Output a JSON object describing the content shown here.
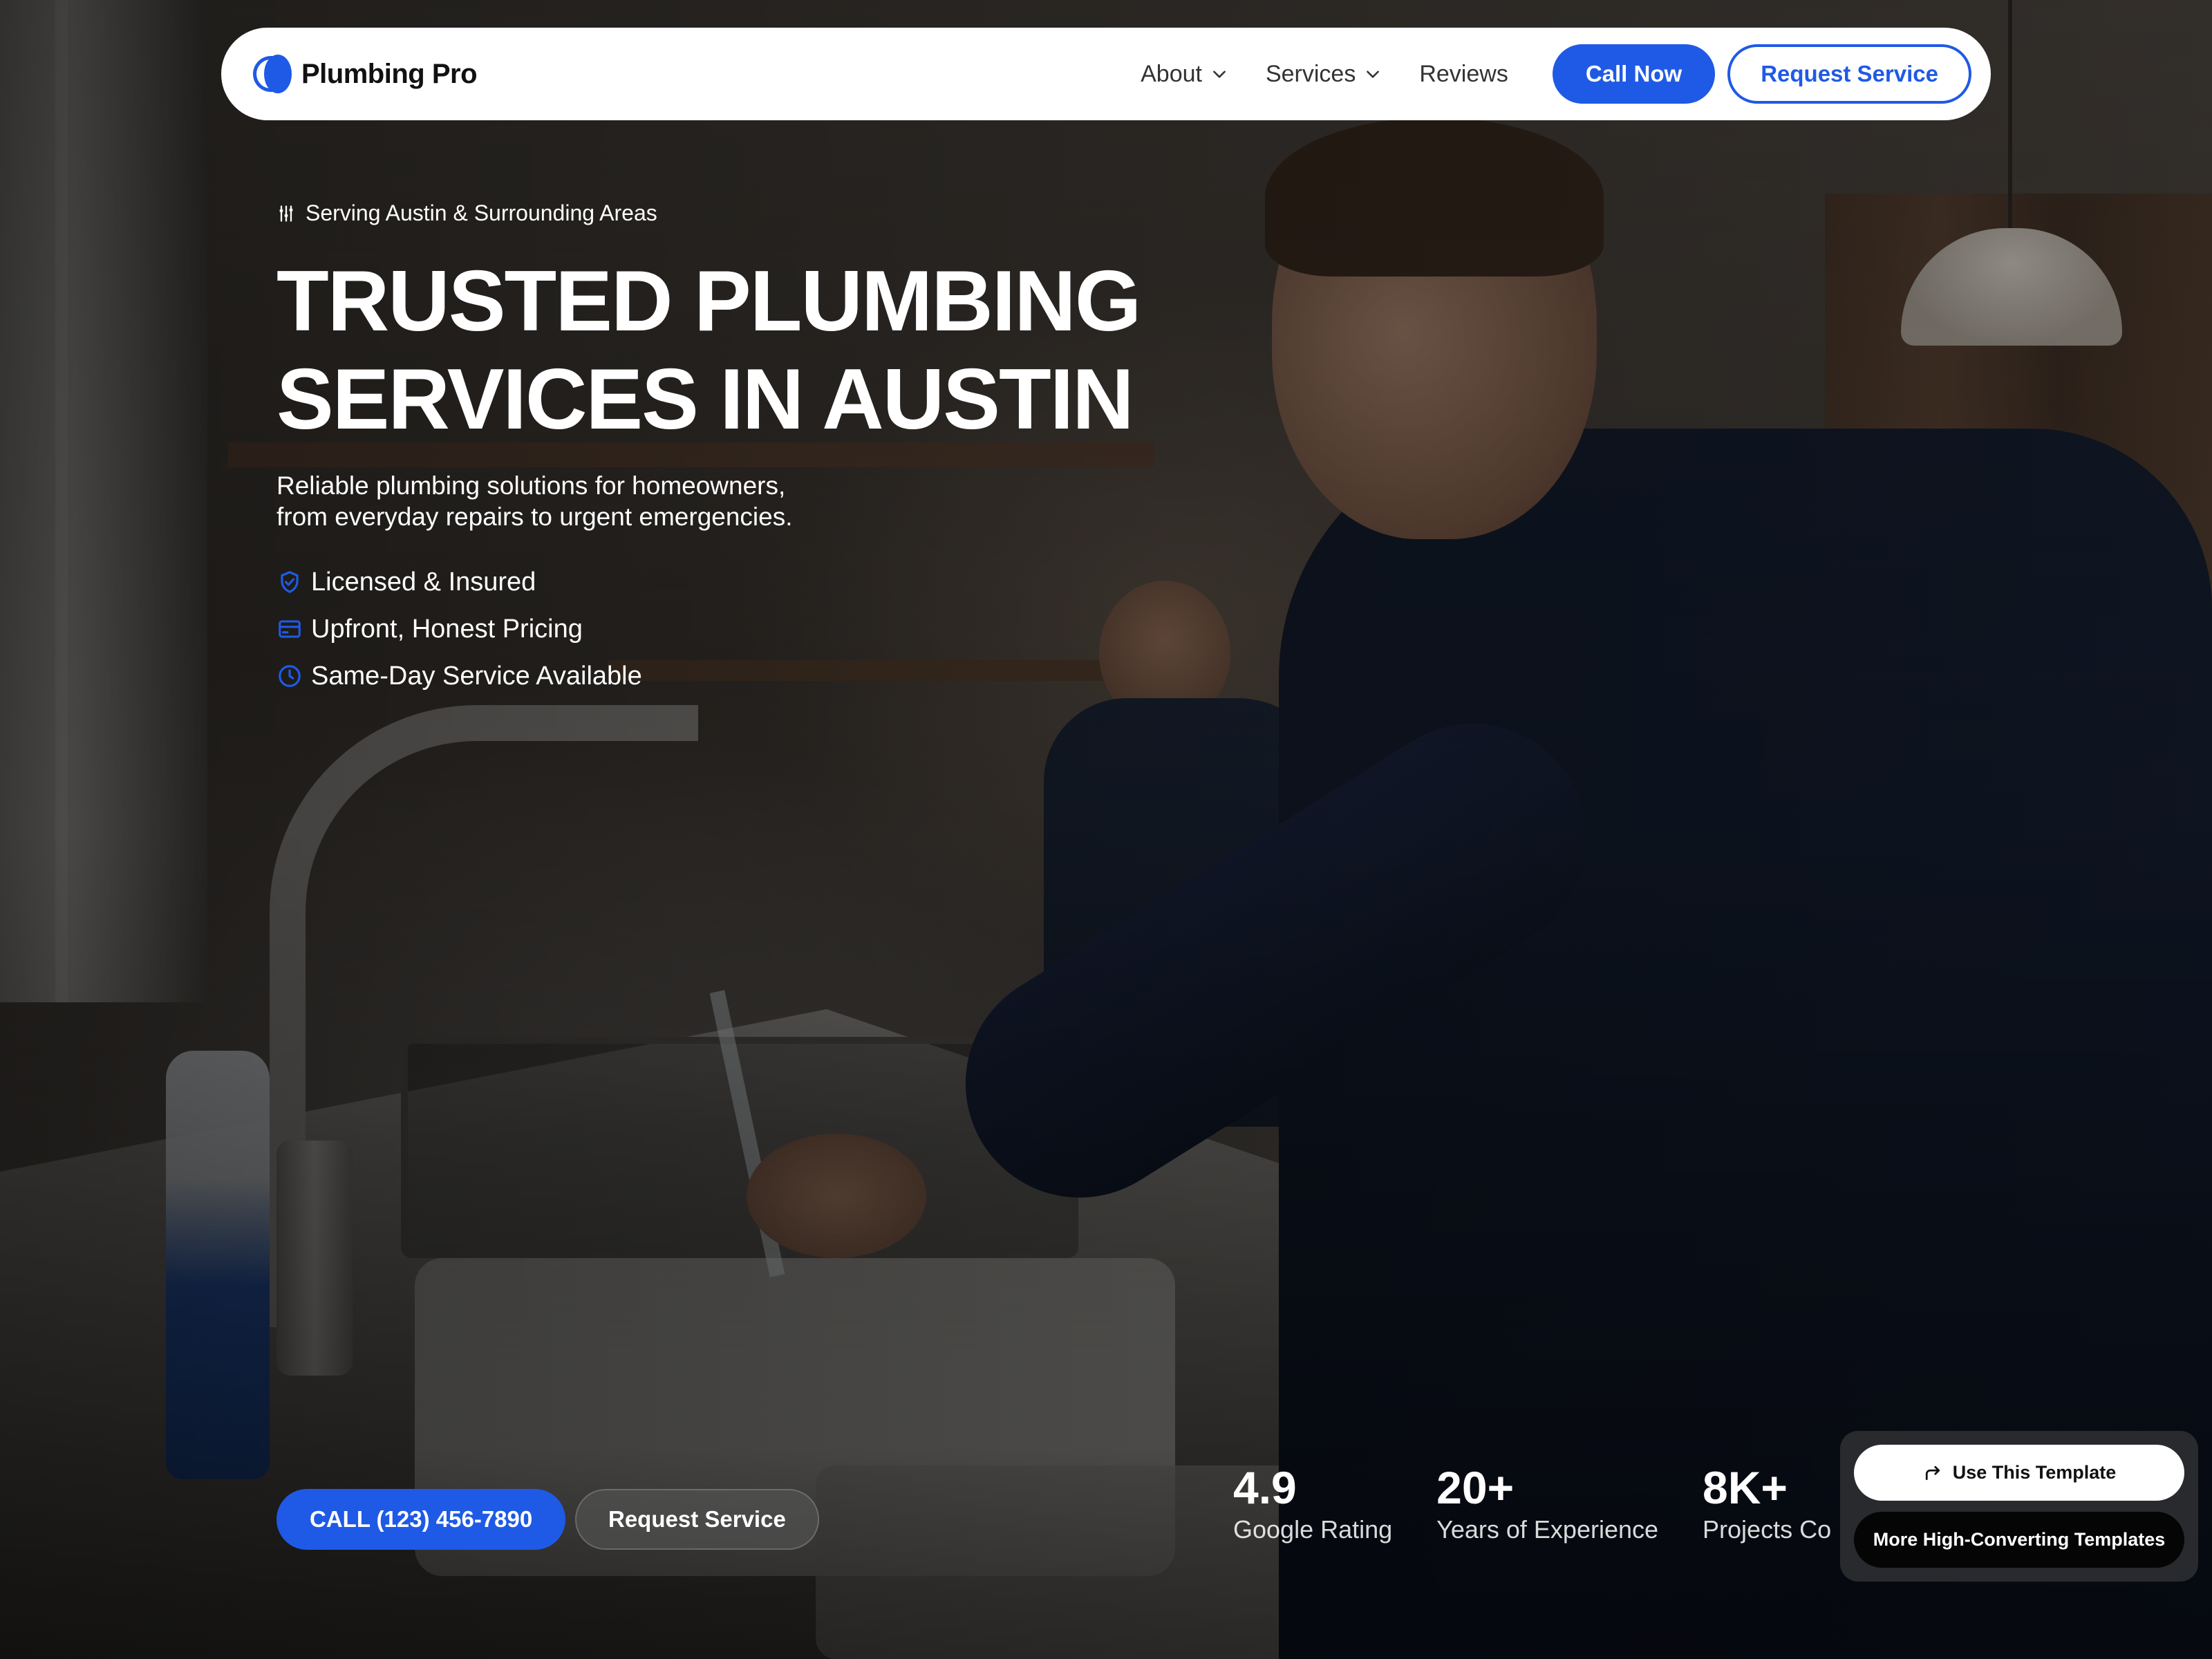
{
  "brand": {
    "name": "Plumbing Pro"
  },
  "nav": {
    "links": [
      {
        "label": "About",
        "has_dropdown": true
      },
      {
        "label": "Services",
        "has_dropdown": true
      },
      {
        "label": "Reviews",
        "has_dropdown": false
      }
    ],
    "call_label": "Call Now",
    "request_label": "Request Service"
  },
  "hero": {
    "eyebrow": "Serving Austin & Surrounding Areas",
    "title_line1": "TRUSTED PLUMBING",
    "title_line2": "SERVICES IN AUSTIN",
    "subtitle_line1": "Reliable plumbing solutions for homeowners,",
    "subtitle_line2": "from everyday repairs to urgent emergencies.",
    "features": [
      {
        "label": "Licensed & Insured",
        "icon": "shield-check-icon"
      },
      {
        "label": "Upfront, Honest Pricing",
        "icon": "credit-card-icon"
      },
      {
        "label": "Same-Day Service Available",
        "icon": "clock-icon"
      }
    ],
    "cta_call": "CALL (123) 456-7890",
    "cta_request": "Request Service"
  },
  "stats": [
    {
      "value": "4.9",
      "label": "Google Rating"
    },
    {
      "value": "20+",
      "label": "Years of Experience"
    },
    {
      "value": "8K+",
      "label": "Projects Co"
    }
  ],
  "template_panel": {
    "use_label": "Use This Template",
    "more_label": "More High-Converting Templates"
  },
  "colors": {
    "accent": "#1f5ae6",
    "nav_bg": "#ffffff",
    "text_light": "#ffffff"
  }
}
